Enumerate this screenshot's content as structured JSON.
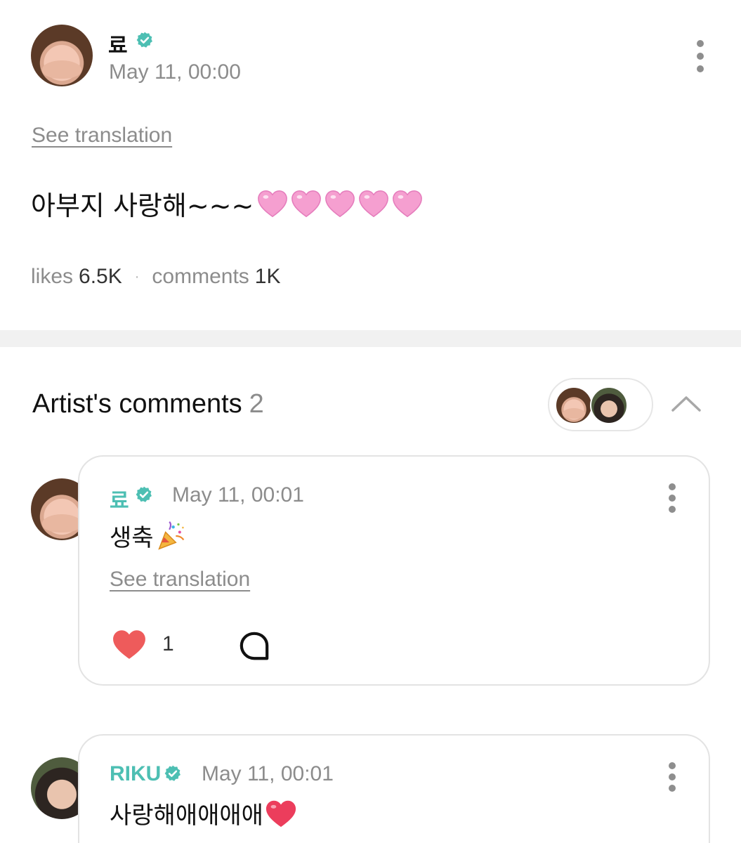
{
  "post": {
    "author_name": "료",
    "timestamp": "May 11, 00:00",
    "see_translation": "See translation",
    "body_text": "아부지 사랑해~~~",
    "body_emoji_count": 5,
    "likes_label": "likes",
    "likes_count": "6.5K",
    "comments_label": "comments",
    "comments_count": "1K",
    "separator": "·"
  },
  "artist_comments": {
    "title": "Artist's comments",
    "count": "2"
  },
  "comments": [
    {
      "author_name": "료",
      "timestamp": "May 11, 00:01",
      "text": "생축",
      "emoji": "party-popper",
      "see_translation": "See translation",
      "like_count": "1"
    },
    {
      "author_name": "RIKU",
      "timestamp": "May 11, 00:01",
      "text": "사랑해애애애애",
      "emoji": "red-heart"
    }
  ],
  "colors": {
    "accent_teal": "#4dbfb3",
    "verified_badge": "#4dbfb3",
    "like_heart": "#ee5b5b",
    "muted_text": "#8c8c8c",
    "pink_heart": "#f59fd0"
  }
}
